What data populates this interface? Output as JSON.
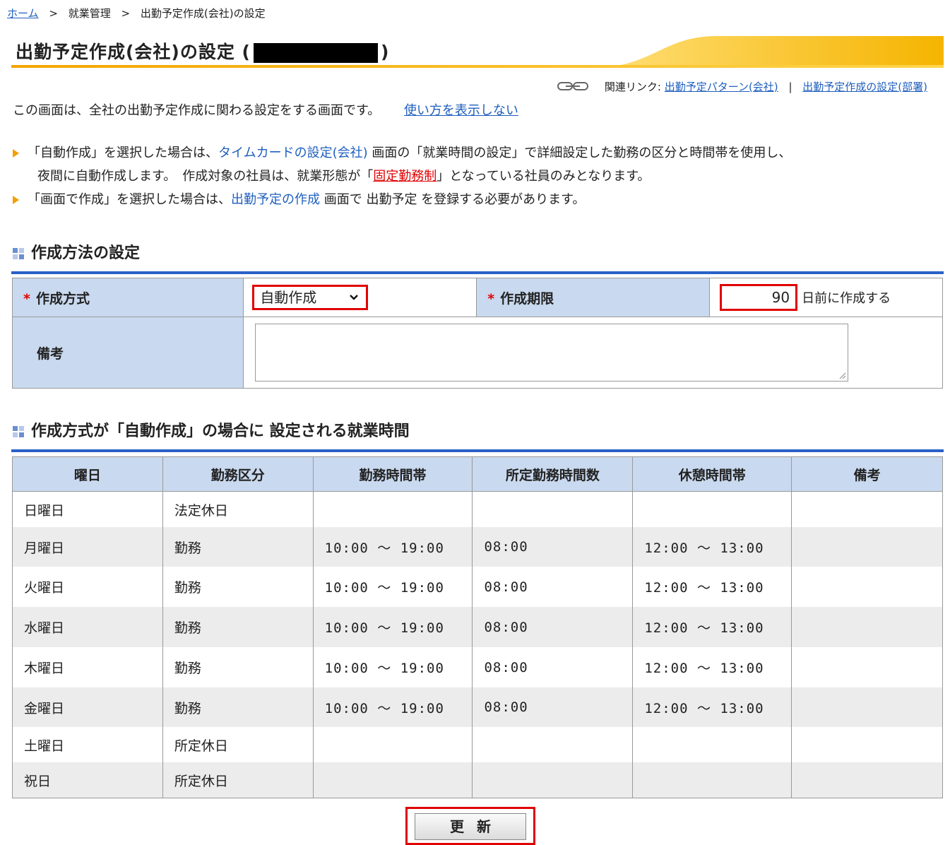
{
  "breadcrumb": {
    "home": "ホーム",
    "sep": ">",
    "level2": "就業管理",
    "current": "出勤予定作成(会社)の設定"
  },
  "header": {
    "title_prefix": "出勤予定作成(会社)の設定 (",
    "title_suffix": ")"
  },
  "related": {
    "label": "関連リンク:",
    "link1": "出勤予定パターン(会社)",
    "divider": "|",
    "link2": "出勤予定作成の設定(部署)"
  },
  "intro": {
    "text": "この画面は、全社の出勤予定作成に関わる設定をする画面です。",
    "toggle_link": "使い方を表示しない"
  },
  "notes": {
    "n1_a": "「自動作成」を選択した場合は、",
    "n1_link": "タイムカードの設定(会社)",
    "n1_b": " 画面の「就業時間の設定」で詳細設定した勤務の区分と時間帯を使用し、",
    "n1_c": "夜間に自動作成します。　作成対象の社員は、就業形態が「",
    "n1_red": "固定勤務制",
    "n1_d": "」となっている社員のみとなります。",
    "n2_a": "「画面で作成」を選択した場合は、",
    "n2_link": "出勤予定の作成",
    "n2_b": " 画面で 出勤予定 を登録する必要があります。"
  },
  "section1": {
    "title": "作成方法の設定"
  },
  "form": {
    "required_mark": "*",
    "method_label": "作成方式",
    "method_value": "自動作成",
    "deadline_label": "作成期限",
    "deadline_value": "90",
    "deadline_unit": "日前に作成する",
    "memo_label": "備考",
    "memo_value": ""
  },
  "section2": {
    "title": "作成方式が「自動作成」の場合に 設定される就業時間"
  },
  "schedule": {
    "headers": [
      "曜日",
      "勤務区分",
      "勤務時間帯",
      "所定勤務時間数",
      "休憩時間帯",
      "備考"
    ],
    "rows": [
      [
        "日曜日",
        "法定休日",
        "",
        "",
        "",
        ""
      ],
      [
        "月曜日",
        "勤務",
        "10:00 ～ 19:00",
        "08:00",
        "12:00 ～ 13:00",
        ""
      ],
      [
        "火曜日",
        "勤務",
        "10:00 ～ 19:00",
        "08:00",
        "12:00 ～ 13:00",
        ""
      ],
      [
        "水曜日",
        "勤務",
        "10:00 ～ 19:00",
        "08:00",
        "12:00 ～ 13:00",
        ""
      ],
      [
        "木曜日",
        "勤務",
        "10:00 ～ 19:00",
        "08:00",
        "12:00 ～ 13:00",
        ""
      ],
      [
        "金曜日",
        "勤務",
        "10:00 ～ 19:00",
        "08:00",
        "12:00 ～ 13:00",
        ""
      ],
      [
        "土曜日",
        "所定休日",
        "",
        "",
        "",
        ""
      ],
      [
        "祝日",
        "所定休日",
        "",
        "",
        "",
        ""
      ]
    ]
  },
  "actions": {
    "update": "更新"
  },
  "colors": {
    "accent_blue": "#2a60c8",
    "label_bg": "#c9d9ef",
    "highlight_red": "#e00000",
    "title_gradient": "#f3a500"
  }
}
